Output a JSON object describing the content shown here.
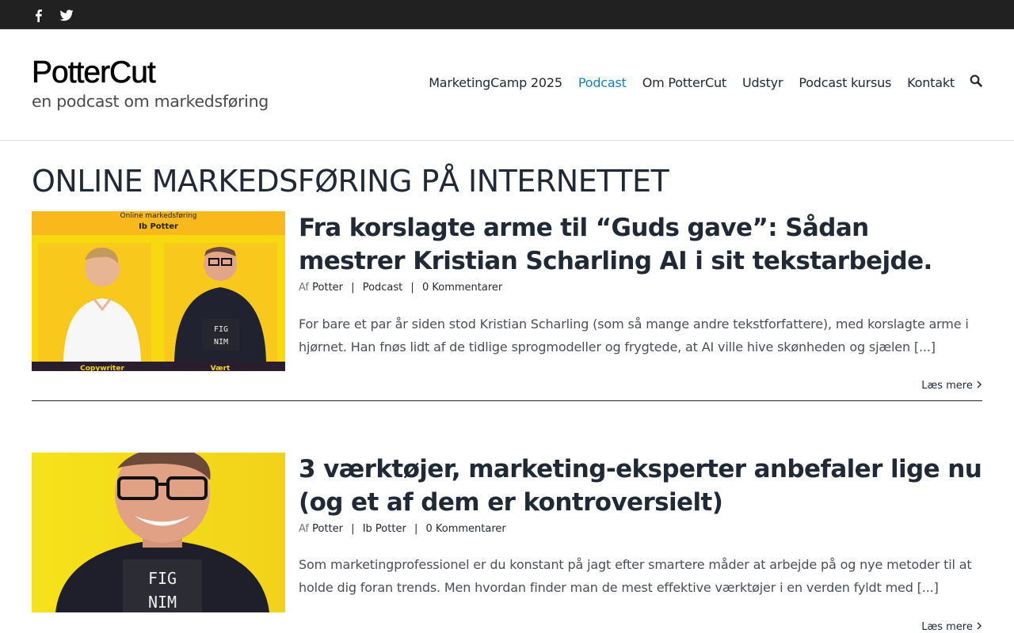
{
  "topbar": {
    "social": [
      {
        "name": "facebook-icon"
      },
      {
        "name": "twitter-icon"
      }
    ]
  },
  "logo": {
    "title": "PotterCut",
    "subtitle": "en podcast om markedsføring"
  },
  "nav": {
    "items": [
      {
        "label": "MarketingCamp 2025",
        "active": false
      },
      {
        "label": "Podcast",
        "active": true
      },
      {
        "label": "Om PotterCut",
        "active": false
      },
      {
        "label": "Udstyr",
        "active": false
      },
      {
        "label": "Podcast kursus",
        "active": false
      },
      {
        "label": "Kontakt",
        "active": false
      }
    ],
    "search_icon": "search-icon",
    "active_color": "#1a80b6"
  },
  "page": {
    "title": "ONLINE MARKEDSFØRING PÅ INTERNETTET"
  },
  "posts": [
    {
      "title": "Fra korslagte arme til “Guds gave”: Sådan mestrer Kristian Scharling AI i sit tekstarbejde.",
      "meta": {
        "by": "Af",
        "author": "Potter",
        "sep": "|",
        "category": "Podcast",
        "comments": "0 Kommentarer"
      },
      "excerpt": "For bare et par år siden stod Kristian Scharling (som så mange andre tekstforfattere), med korslagte arme i hjørnet. Han fnøs lidt af de tidlige sprogmodeller og frygtede, at AI ville hive skønheden og sjælen [...]",
      "more": "Læs mere",
      "thumb": {
        "banner": "Online markedsføring",
        "name": "Ib Potter",
        "shirt": [
          "FIG",
          "NIM"
        ],
        "left_caption": "Copywriter",
        "right_caption": "Vært"
      }
    },
    {
      "title": "3 værktøjer, marketing-eksperter anbefaler lige nu (og et af dem er kontroversielt)",
      "meta": {
        "by": "Af",
        "author": "Potter",
        "sep": "|",
        "category": "Ib Potter",
        "comments": "0 Kommentarer"
      },
      "excerpt": "Som marketingprofessionel er du konstant på jagt efter smartere måder at arbejde på og nye metoder til at holde dig foran trends. Men hvordan finder man de mest effektive værktøjer i en verden fyldt med [...]",
      "more": "Læs mere",
      "thumb": {
        "shirt": [
          "FIG",
          "NIM"
        ]
      }
    }
  ],
  "colors": {
    "topbar": "#212121",
    "text": "#212934",
    "thumb_yellow": "#f6e21a",
    "thumb_orange": "#f9b81b"
  }
}
